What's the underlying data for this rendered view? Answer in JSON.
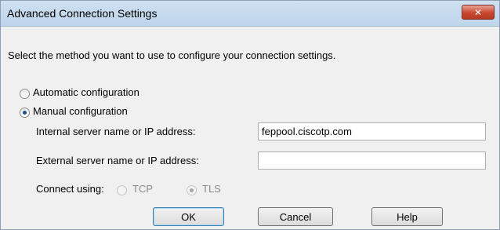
{
  "window": {
    "title": "Advanced Connection Settings",
    "close_symbol": "✕"
  },
  "instruction": "Select the method you want to use to configure your connection settings.",
  "method": {
    "automatic_label": "Automatic configuration",
    "manual_label": "Manual configuration",
    "selected": "manual"
  },
  "fields": {
    "internal_label": "Internal server name or IP address:",
    "internal_value": "feppool.ciscotp.com",
    "external_label": "External server name or IP address:",
    "external_value": ""
  },
  "connect_using": {
    "label": "Connect using:",
    "tcp_label": "TCP",
    "tls_label": "TLS",
    "selected": "TLS"
  },
  "buttons": {
    "ok": "OK",
    "cancel": "Cancel",
    "help": "Help"
  },
  "colors": {
    "titlebar": "#cfe0f1",
    "close_button": "#c9482f",
    "dialog_bg": "#f0f0f0"
  }
}
